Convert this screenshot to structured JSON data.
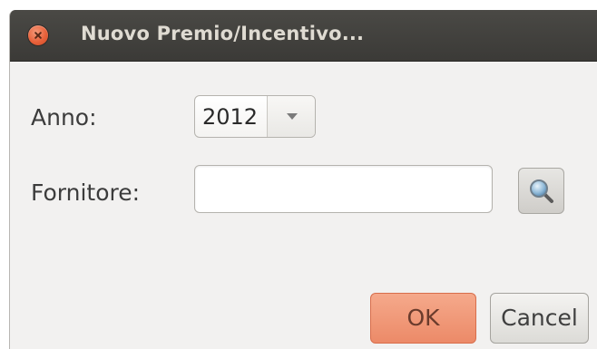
{
  "window": {
    "title": "Nuovo Premio/Incentivo..."
  },
  "form": {
    "anno_label": "Anno:",
    "anno_value": "2012",
    "fornitore_label": "Fornitore:",
    "fornitore_value": "",
    "fornitore_placeholder": ""
  },
  "buttons": {
    "ok": "OK",
    "cancel": "Cancel"
  },
  "icons": {
    "close": "close-icon",
    "dropdown": "chevron-down-icon",
    "search": "magnifier-icon"
  },
  "colors": {
    "titlebar": "#3f3e3b",
    "close_button": "#e8613a",
    "ok_button": "#ef8f6c",
    "background": "#f2f1f0"
  }
}
